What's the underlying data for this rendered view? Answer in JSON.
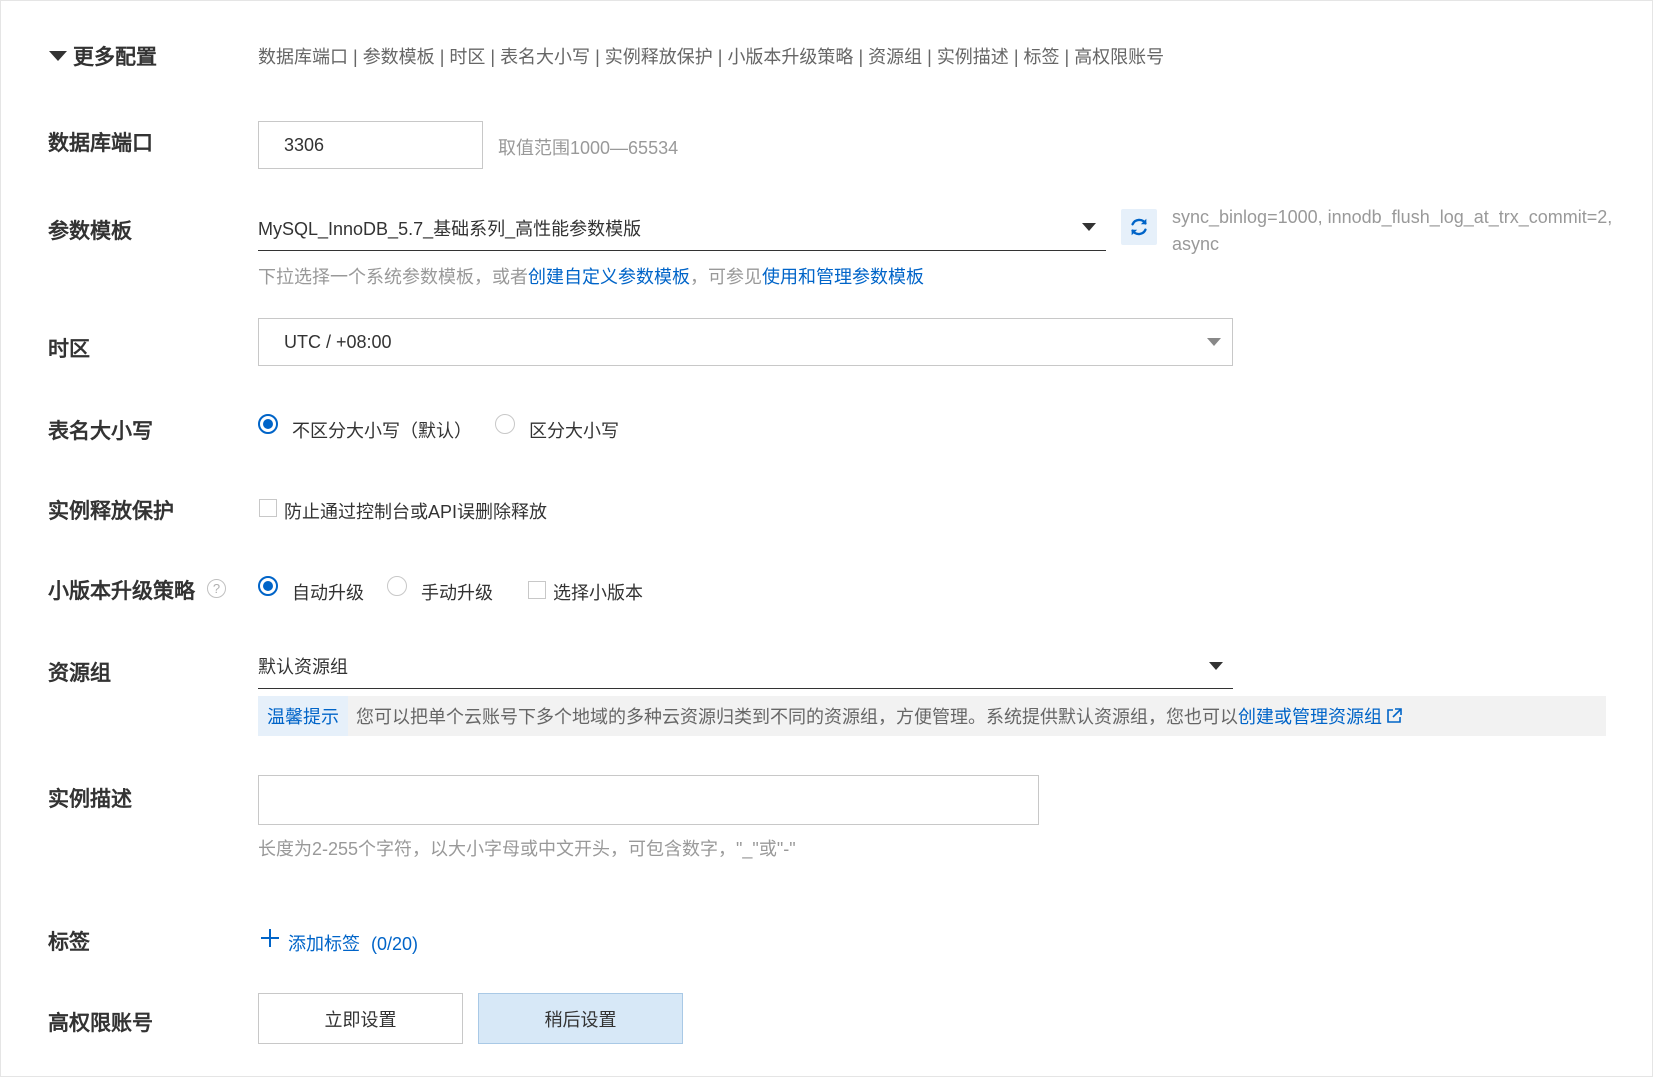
{
  "section": {
    "title": "更多配置",
    "links": [
      "数据库端口",
      "参数模板",
      "时区",
      "表名大小写",
      "实例释放保护",
      "小版本升级策略",
      "资源组",
      "实例描述",
      "标签",
      "高权限账号"
    ]
  },
  "port": {
    "label": "数据库端口",
    "value": "3306",
    "hint": "取值范围1000—65534"
  },
  "param_template": {
    "label": "参数模板",
    "selected": "MySQL_InnoDB_5.7_基础系列_高性能参数模版",
    "info_line1": "sync_binlog=1000, innodb_flush_log_at_trx_commit=2,",
    "info_line2": "async",
    "hint_prefix": "下拉选择一个系统参数模板，或者",
    "hint_link1": "创建自定义参数模板",
    "hint_mid": "，可参见",
    "hint_link2": "使用和管理参数模板"
  },
  "timezone": {
    "label": "时区",
    "selected": "UTC / +08:00"
  },
  "table_case": {
    "label": "表名大小写",
    "options": [
      "不区分大小写（默认）",
      "区分大小写"
    ],
    "selected_index": 0
  },
  "release_protection": {
    "label": "实例释放保护",
    "checkbox_label": "防止通过控制台或API误删除释放",
    "checked": false
  },
  "upgrade_policy": {
    "label": "小版本升级策略",
    "help_icon": "question-icon",
    "help_symbol": "?",
    "options": [
      "自动升级",
      "手动升级"
    ],
    "selected_index": 0,
    "checkbox_label": "选择小版本",
    "checked": false
  },
  "resource_group": {
    "label": "资源组",
    "selected": "默认资源组",
    "tip_tag": "温馨提示",
    "tip_text": "您可以把单个云账号下多个地域的多种云资源归类到不同的资源组，方便管理。系统提供默认资源组，您也可以",
    "tip_link": "创建或管理资源组"
  },
  "description": {
    "label": "实例描述",
    "value": "",
    "hint": "长度为2-255个字符，以大小字母或中文开头，可包含数字，\"_\"或\"-\""
  },
  "tags": {
    "label": "标签",
    "add_label": "添加标签",
    "count": "(0/20)"
  },
  "admin_account": {
    "label": "高权限账号",
    "buttons": [
      "立即设置",
      "稍后设置"
    ],
    "active_index": 1
  },
  "colors": {
    "accent": "#0064c8",
    "text": "#333333",
    "muted": "#999999",
    "tip_bg": "#f2f2f2",
    "active_btn_bg": "#d7e8f7"
  }
}
